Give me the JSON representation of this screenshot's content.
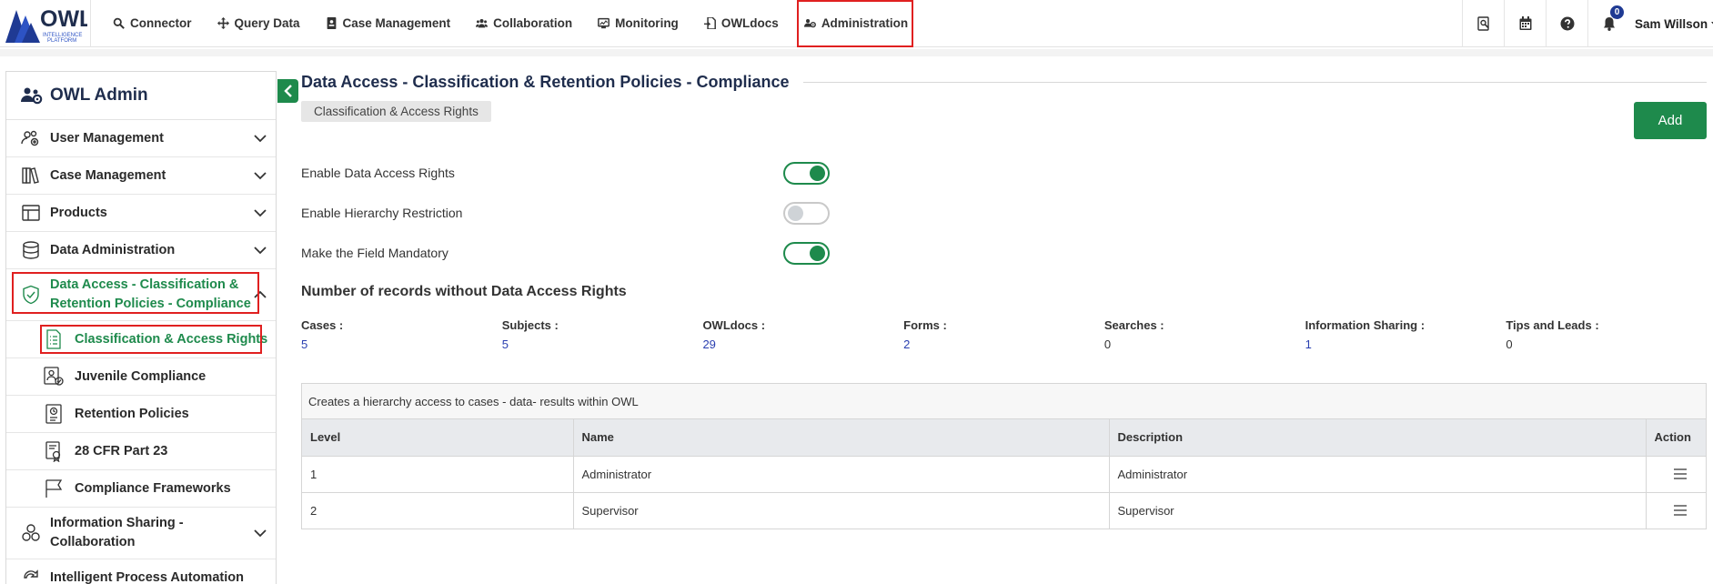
{
  "logo": {
    "text": "OWL",
    "sub1": "INTELLIGENCE",
    "sub2": "PLATFORM"
  },
  "nav": {
    "items": [
      {
        "label": "Connector",
        "icon": "search-icon"
      },
      {
        "label": "Query Data",
        "icon": "arrows-icon"
      },
      {
        "label": "Case Management",
        "icon": "id-card-icon"
      },
      {
        "label": "Collaboration",
        "icon": "users-icon"
      },
      {
        "label": "Monitoring",
        "icon": "monitor-icon"
      },
      {
        "label": "OWLdocs",
        "icon": "document-icon"
      },
      {
        "label": "Administration",
        "icon": "users-gear-icon"
      }
    ]
  },
  "topbar": {
    "notification_count": "0",
    "user_name": "Sam Willson"
  },
  "sidebar": {
    "title": "OWL Admin",
    "items": [
      {
        "label": "User Management"
      },
      {
        "label": "Case Management"
      },
      {
        "label": "Products"
      },
      {
        "label": "Data Administration"
      },
      {
        "label_line1": "Data Access - Classification &",
        "label_line2": "Retention Policies - Compliance"
      },
      {
        "label": "Classification & Access Rights"
      },
      {
        "label": "Juvenile Compliance"
      },
      {
        "label": "Retention Policies"
      },
      {
        "label": "28 CFR Part 23"
      },
      {
        "label": "Compliance Frameworks"
      },
      {
        "label_line1": "Information Sharing -",
        "label_line2": "Collaboration"
      },
      {
        "label": "Intelligent Process Automation"
      }
    ]
  },
  "main": {
    "title": "Data Access - Classification & Retention Policies - Compliance",
    "chip": "Classification & Access Rights",
    "add_label": "Add",
    "toggles": [
      {
        "label": "Enable Data Access Rights",
        "on": true
      },
      {
        "label": "Enable Hierarchy Restriction",
        "on": false
      },
      {
        "label": "Make the Field Mandatory",
        "on": true
      }
    ],
    "records_title": "Number of records without Data Access Rights",
    "stats": [
      {
        "label": "Cases :",
        "value": "5"
      },
      {
        "label": "Subjects :",
        "value": "5"
      },
      {
        "label": "OWLdocs :",
        "value": "29"
      },
      {
        "label": "Forms :",
        "value": "2"
      },
      {
        "label": "Searches :",
        "value": "0"
      },
      {
        "label": "Information Sharing :",
        "value": "1"
      },
      {
        "label": "Tips and Leads :",
        "value": "0"
      }
    ],
    "table": {
      "caption": "Creates a hierarchy access to cases - data- results within OWL",
      "headers": [
        "Level",
        "Name",
        "Description",
        "Action"
      ],
      "rows": [
        {
          "level": "1",
          "name": "Administrator",
          "description": "Administrator"
        },
        {
          "level": "2",
          "name": "Supervisor",
          "description": "Supervisor"
        }
      ]
    }
  },
  "colors": {
    "accent": "#1e8a4c",
    "heading": "#1f2d4d",
    "link": "#2a3fb0",
    "highlight": "#e02020"
  }
}
